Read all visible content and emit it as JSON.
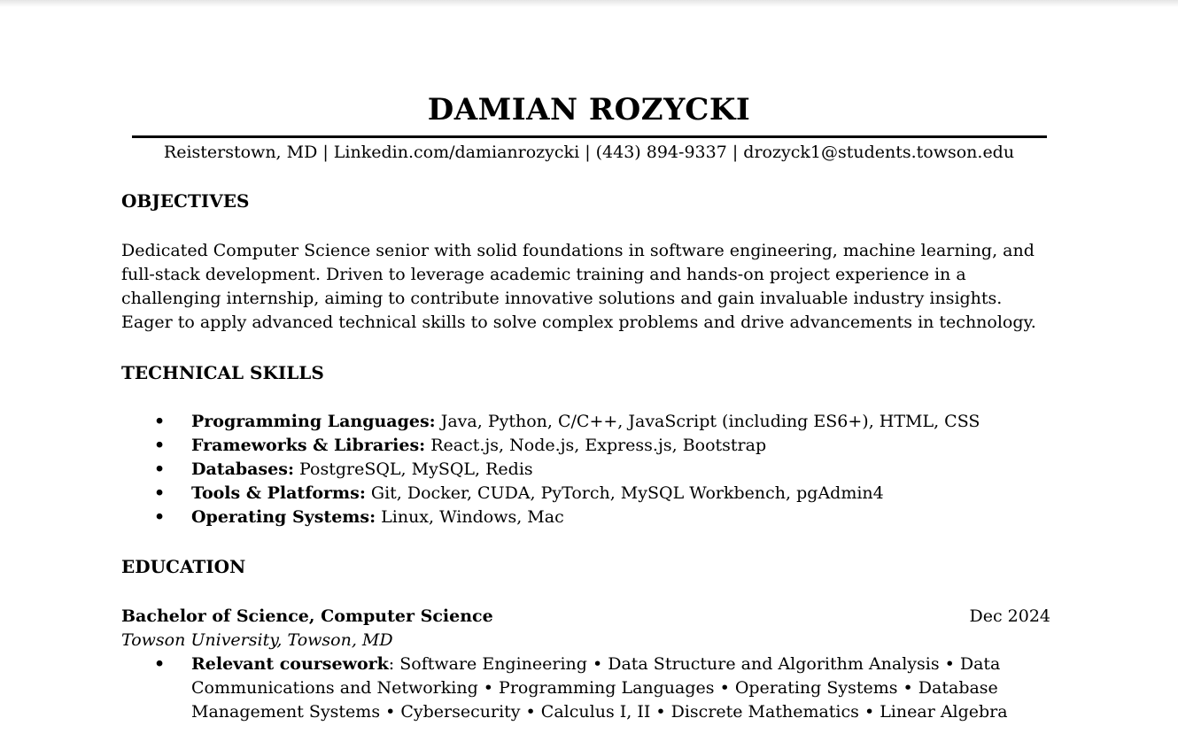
{
  "header": {
    "name": "DAMIAN ROZYCKI",
    "contact": "Reisterstown, MD | Linkedin.com/damianrozycki | (443) 894-9337 | drozyck1@students.towson.edu"
  },
  "objectives": {
    "heading": "OBJECTIVES",
    "lines": [
      "Dedicated Computer Science senior with solid foundations in software engineering, machine learning, and",
      "full-stack development. Driven to leverage academic training and hands-on project experience in a",
      "challenging internship, aiming to contribute innovative solutions and gain invaluable industry insights.",
      "Eager to apply advanced technical skills to solve complex problems and drive advancements in technology."
    ]
  },
  "skills": {
    "heading": "TECHNICAL SKILLS",
    "bullet": "•",
    "items": [
      {
        "label": "Programming Languages:",
        "value": " Java, Python, C/C++, JavaScript (including ES6+), HTML, CSS"
      },
      {
        "label": "Frameworks & Libraries:",
        "value": " React.js, Node.js, Express.js, Bootstrap"
      },
      {
        "label": "Databases:",
        "value": " PostgreSQL, MySQL, Redis"
      },
      {
        "label": "Tools & Platforms:",
        "value": " Git, Docker, CUDA, PyTorch, MySQL Workbench, pgAdmin4"
      },
      {
        "label": "Operating Systems:",
        "value": " Linux, Windows, Mac"
      }
    ]
  },
  "education": {
    "heading": "EDUCATION",
    "degree": "Bachelor of Science, Computer Science",
    "date": "Dec 2024",
    "school": "Towson University, Towson, MD",
    "coursework_label": "Relevant coursework",
    "coursework_colon": ":",
    "coursework_lines": [
      " Software Engineering • Data Structure and Algorithm Analysis • Data",
      "Communications and Networking • Programming Languages • Operating Systems • Database",
      "Management Systems • Cybersecurity • Calculus I, II • Discrete Mathematics • Linear Algebra"
    ]
  }
}
